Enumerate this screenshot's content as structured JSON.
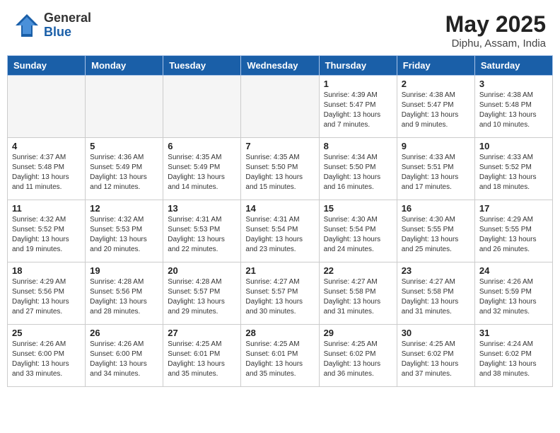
{
  "header": {
    "logo": {
      "general": "General",
      "blue": "Blue"
    },
    "month": "May 2025",
    "location": "Diphu, Assam, India"
  },
  "weekdays": [
    "Sunday",
    "Monday",
    "Tuesday",
    "Wednesday",
    "Thursday",
    "Friday",
    "Saturday"
  ],
  "weeks": [
    [
      {
        "day": "",
        "empty": true
      },
      {
        "day": "",
        "empty": true
      },
      {
        "day": "",
        "empty": true
      },
      {
        "day": "",
        "empty": true
      },
      {
        "day": "1",
        "sunrise": "4:39 AM",
        "sunset": "5:47 PM",
        "daylight": "13 hours and 7 minutes."
      },
      {
        "day": "2",
        "sunrise": "4:38 AM",
        "sunset": "5:47 PM",
        "daylight": "13 hours and 9 minutes."
      },
      {
        "day": "3",
        "sunrise": "4:38 AM",
        "sunset": "5:48 PM",
        "daylight": "13 hours and 10 minutes."
      }
    ],
    [
      {
        "day": "4",
        "sunrise": "4:37 AM",
        "sunset": "5:48 PM",
        "daylight": "13 hours and 11 minutes."
      },
      {
        "day": "5",
        "sunrise": "4:36 AM",
        "sunset": "5:49 PM",
        "daylight": "13 hours and 12 minutes."
      },
      {
        "day": "6",
        "sunrise": "4:35 AM",
        "sunset": "5:49 PM",
        "daylight": "13 hours and 14 minutes."
      },
      {
        "day": "7",
        "sunrise": "4:35 AM",
        "sunset": "5:50 PM",
        "daylight": "13 hours and 15 minutes."
      },
      {
        "day": "8",
        "sunrise": "4:34 AM",
        "sunset": "5:50 PM",
        "daylight": "13 hours and 16 minutes."
      },
      {
        "day": "9",
        "sunrise": "4:33 AM",
        "sunset": "5:51 PM",
        "daylight": "13 hours and 17 minutes."
      },
      {
        "day": "10",
        "sunrise": "4:33 AM",
        "sunset": "5:52 PM",
        "daylight": "13 hours and 18 minutes."
      }
    ],
    [
      {
        "day": "11",
        "sunrise": "4:32 AM",
        "sunset": "5:52 PM",
        "daylight": "13 hours and 19 minutes."
      },
      {
        "day": "12",
        "sunrise": "4:32 AM",
        "sunset": "5:53 PM",
        "daylight": "13 hours and 20 minutes."
      },
      {
        "day": "13",
        "sunrise": "4:31 AM",
        "sunset": "5:53 PM",
        "daylight": "13 hours and 22 minutes."
      },
      {
        "day": "14",
        "sunrise": "4:31 AM",
        "sunset": "5:54 PM",
        "daylight": "13 hours and 23 minutes."
      },
      {
        "day": "15",
        "sunrise": "4:30 AM",
        "sunset": "5:54 PM",
        "daylight": "13 hours and 24 minutes."
      },
      {
        "day": "16",
        "sunrise": "4:30 AM",
        "sunset": "5:55 PM",
        "daylight": "13 hours and 25 minutes."
      },
      {
        "day": "17",
        "sunrise": "4:29 AM",
        "sunset": "5:55 PM",
        "daylight": "13 hours and 26 minutes."
      }
    ],
    [
      {
        "day": "18",
        "sunrise": "4:29 AM",
        "sunset": "5:56 PM",
        "daylight": "13 hours and 27 minutes."
      },
      {
        "day": "19",
        "sunrise": "4:28 AM",
        "sunset": "5:56 PM",
        "daylight": "13 hours and 28 minutes."
      },
      {
        "day": "20",
        "sunrise": "4:28 AM",
        "sunset": "5:57 PM",
        "daylight": "13 hours and 29 minutes."
      },
      {
        "day": "21",
        "sunrise": "4:27 AM",
        "sunset": "5:57 PM",
        "daylight": "13 hours and 30 minutes."
      },
      {
        "day": "22",
        "sunrise": "4:27 AM",
        "sunset": "5:58 PM",
        "daylight": "13 hours and 31 minutes."
      },
      {
        "day": "23",
        "sunrise": "4:27 AM",
        "sunset": "5:58 PM",
        "daylight": "13 hours and 31 minutes."
      },
      {
        "day": "24",
        "sunrise": "4:26 AM",
        "sunset": "5:59 PM",
        "daylight": "13 hours and 32 minutes."
      }
    ],
    [
      {
        "day": "25",
        "sunrise": "4:26 AM",
        "sunset": "6:00 PM",
        "daylight": "13 hours and 33 minutes."
      },
      {
        "day": "26",
        "sunrise": "4:26 AM",
        "sunset": "6:00 PM",
        "daylight": "13 hours and 34 minutes."
      },
      {
        "day": "27",
        "sunrise": "4:25 AM",
        "sunset": "6:01 PM",
        "daylight": "13 hours and 35 minutes."
      },
      {
        "day": "28",
        "sunrise": "4:25 AM",
        "sunset": "6:01 PM",
        "daylight": "13 hours and 35 minutes."
      },
      {
        "day": "29",
        "sunrise": "4:25 AM",
        "sunset": "6:02 PM",
        "daylight": "13 hours and 36 minutes."
      },
      {
        "day": "30",
        "sunrise": "4:25 AM",
        "sunset": "6:02 PM",
        "daylight": "13 hours and 37 minutes."
      },
      {
        "day": "31",
        "sunrise": "4:24 AM",
        "sunset": "6:02 PM",
        "daylight": "13 hours and 38 minutes."
      }
    ]
  ]
}
